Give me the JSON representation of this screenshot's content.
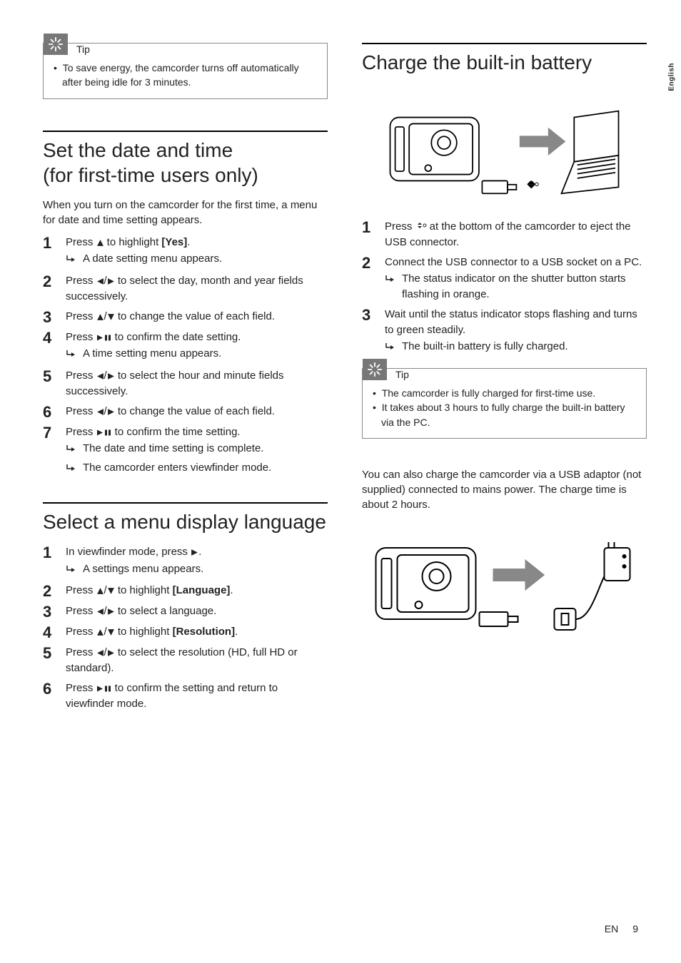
{
  "side_tab": "English",
  "footer": {
    "lang": "EN",
    "page": "9"
  },
  "tip_label": "Tip",
  "left": {
    "tip_items": [
      "To save energy, the camcorder turns off automatically after being idle for 3 minutes."
    ],
    "sec1_title_a": "Set the date and time",
    "sec1_title_b": "(for first-time users only)",
    "sec1_intro": "When you turn on the camcorder for the first time, a menu for date and time setting appears.",
    "steps1": [
      {
        "n": "1",
        "pre": "Press ",
        "icon": "up",
        "post": " to highlight ",
        "bold": "[Yes]",
        "tail": ".",
        "results": [
          "A date setting menu appears."
        ]
      },
      {
        "n": "2",
        "pre": "Press ",
        "icon": "lr",
        "post": " to select the day, month and year fields successively."
      },
      {
        "n": "3",
        "pre": "Press ",
        "icon": "ud",
        "post": " to change the value of each field."
      },
      {
        "n": "4",
        "pre": "Press ",
        "icon": "playpause",
        "post": " to confirm the date setting.",
        "results": [
          "A time setting menu appears."
        ]
      },
      {
        "n": "5",
        "pre": "Press ",
        "icon": "lr",
        "post": " to select the hour and minute fields successively."
      },
      {
        "n": "6",
        "pre": "Press ",
        "icon": "lr",
        "post": " to change the value of each field."
      },
      {
        "n": "7",
        "pre": "Press ",
        "icon": "playpause",
        "post": " to confirm the time setting.",
        "results": [
          "The date and time setting is complete.",
          "The camcorder enters viewfinder mode."
        ]
      }
    ],
    "sec2_title": "Select a menu display language",
    "steps2": [
      {
        "n": "1",
        "pre": "In viewfinder mode, press ",
        "icon": "right",
        "post": ".",
        "results": [
          "A settings menu appears."
        ]
      },
      {
        "n": "2",
        "pre": "Press ",
        "icon": "ud",
        "post": " to highlight ",
        "bold": "[Language]",
        "tail": "."
      },
      {
        "n": "3",
        "pre": "Press ",
        "icon": "lr",
        "post": " to select a language."
      },
      {
        "n": "4",
        "pre": "Press ",
        "icon": "ud",
        "post": " to highlight ",
        "bold": "[Resolution]",
        "tail": "."
      },
      {
        "n": "5",
        "pre": "Press ",
        "icon": "lr",
        "post": " to select the resolution (HD, full HD or standard)."
      },
      {
        "n": "6",
        "pre": "Press ",
        "icon": "playpause",
        "post": " to confirm the setting and return to viewfinder mode."
      }
    ]
  },
  "right": {
    "sec_title": "Charge the built-in battery",
    "steps": [
      {
        "n": "1",
        "pre": "Press ",
        "icon": "eject",
        "post": " at the bottom of the camcorder to eject the USB connector."
      },
      {
        "n": "2",
        "pre": "Connect the USB connector to a USB socket on a PC.",
        "results": [
          "The status indicator on the shutter button starts flashing in orange."
        ]
      },
      {
        "n": "3",
        "pre": "Wait until the status indicator stops flashing and turns to green steadily.",
        "results": [
          "The built-in battery is fully charged."
        ]
      }
    ],
    "tip_items": [
      "The camcorder is fully charged for first-time use.",
      "It takes about 3 hours to fully charge the built-in battery via the PC."
    ],
    "after_tip": "You can also charge the camcorder via a USB adaptor (not supplied) connected to mains power. The charge time is about 2 hours."
  }
}
